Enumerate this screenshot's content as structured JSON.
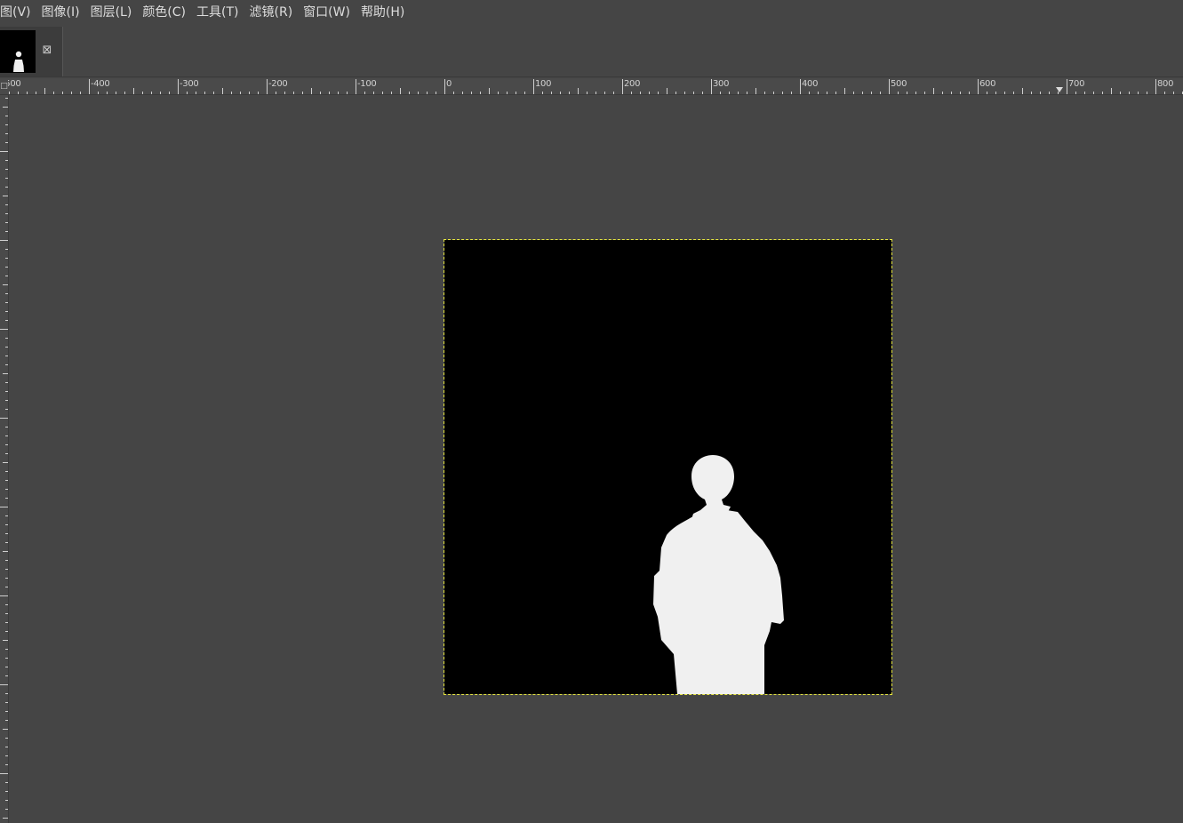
{
  "menubar": {
    "items": [
      {
        "name": "menu-view",
        "label": "图(V)"
      },
      {
        "name": "menu-image",
        "label": "图像(I)"
      },
      {
        "name": "menu-layer",
        "label": "图层(L)"
      },
      {
        "name": "menu-colors",
        "label": "颜色(C)"
      },
      {
        "name": "menu-tools",
        "label": "工具(T)"
      },
      {
        "name": "menu-filters",
        "label": "滤镜(R)"
      },
      {
        "name": "menu-windows",
        "label": "窗口(W)"
      },
      {
        "name": "menu-help",
        "label": "帮助(H)"
      }
    ]
  },
  "image_tab": {
    "close_glyph": "⊠",
    "thumbnail_icon": "image-thumbnail-icon"
  },
  "ruler": {
    "corner_label": "□",
    "horizontal_labels": [
      "-500",
      "-400",
      "-300",
      "-200",
      "-100",
      "0",
      "100",
      "200",
      "300",
      "400",
      "500",
      "600",
      "700",
      "800"
    ],
    "vertical_labels": [
      "-100",
      "0",
      "100",
      "200",
      "300",
      "400",
      "500",
      "600"
    ]
  },
  "canvas": {
    "background_color": "#000000",
    "figure_color": "#f0f0f0",
    "boundary_color": "#e6e640",
    "content_description_icon": "person-silhouette-mask"
  }
}
